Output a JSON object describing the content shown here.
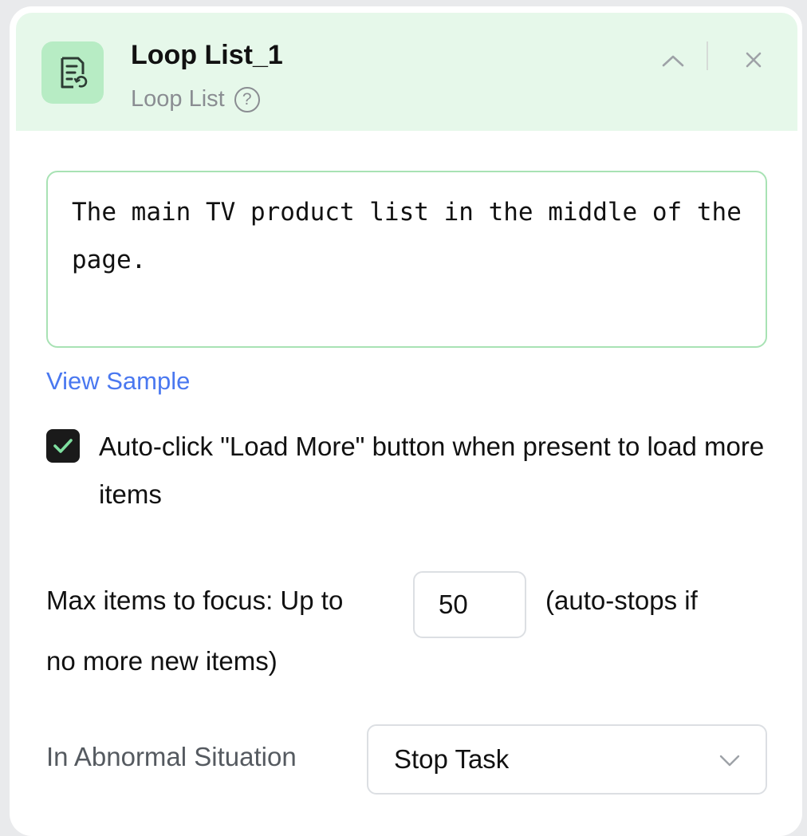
{
  "header": {
    "title": "Loop List_1",
    "subtitle": "Loop List",
    "help_icon": "?",
    "icon_name": "loop-list-icon",
    "accent_color": "#e6f8ea",
    "icon_bg_color": "#b7ecc4"
  },
  "description": {
    "value": "The main TV product list in the middle of the page."
  },
  "links": {
    "view_sample": "View Sample"
  },
  "auto_click": {
    "checked": true,
    "label": "Auto-click \"Load More\" button when present to load more items"
  },
  "max_items": {
    "label": "Max items to focus: Up to",
    "value": "50",
    "suffix_line1": "(auto-stops if",
    "suffix_line2": "no more new items)"
  },
  "abnormal": {
    "label": "In Abnormal Situation",
    "value": "Stop Task"
  },
  "colors": {
    "link": "#4a78f0",
    "checkbox": "#1a1a1a",
    "check_mark": "#7fe0a0",
    "border_green": "#a8e2b4"
  }
}
